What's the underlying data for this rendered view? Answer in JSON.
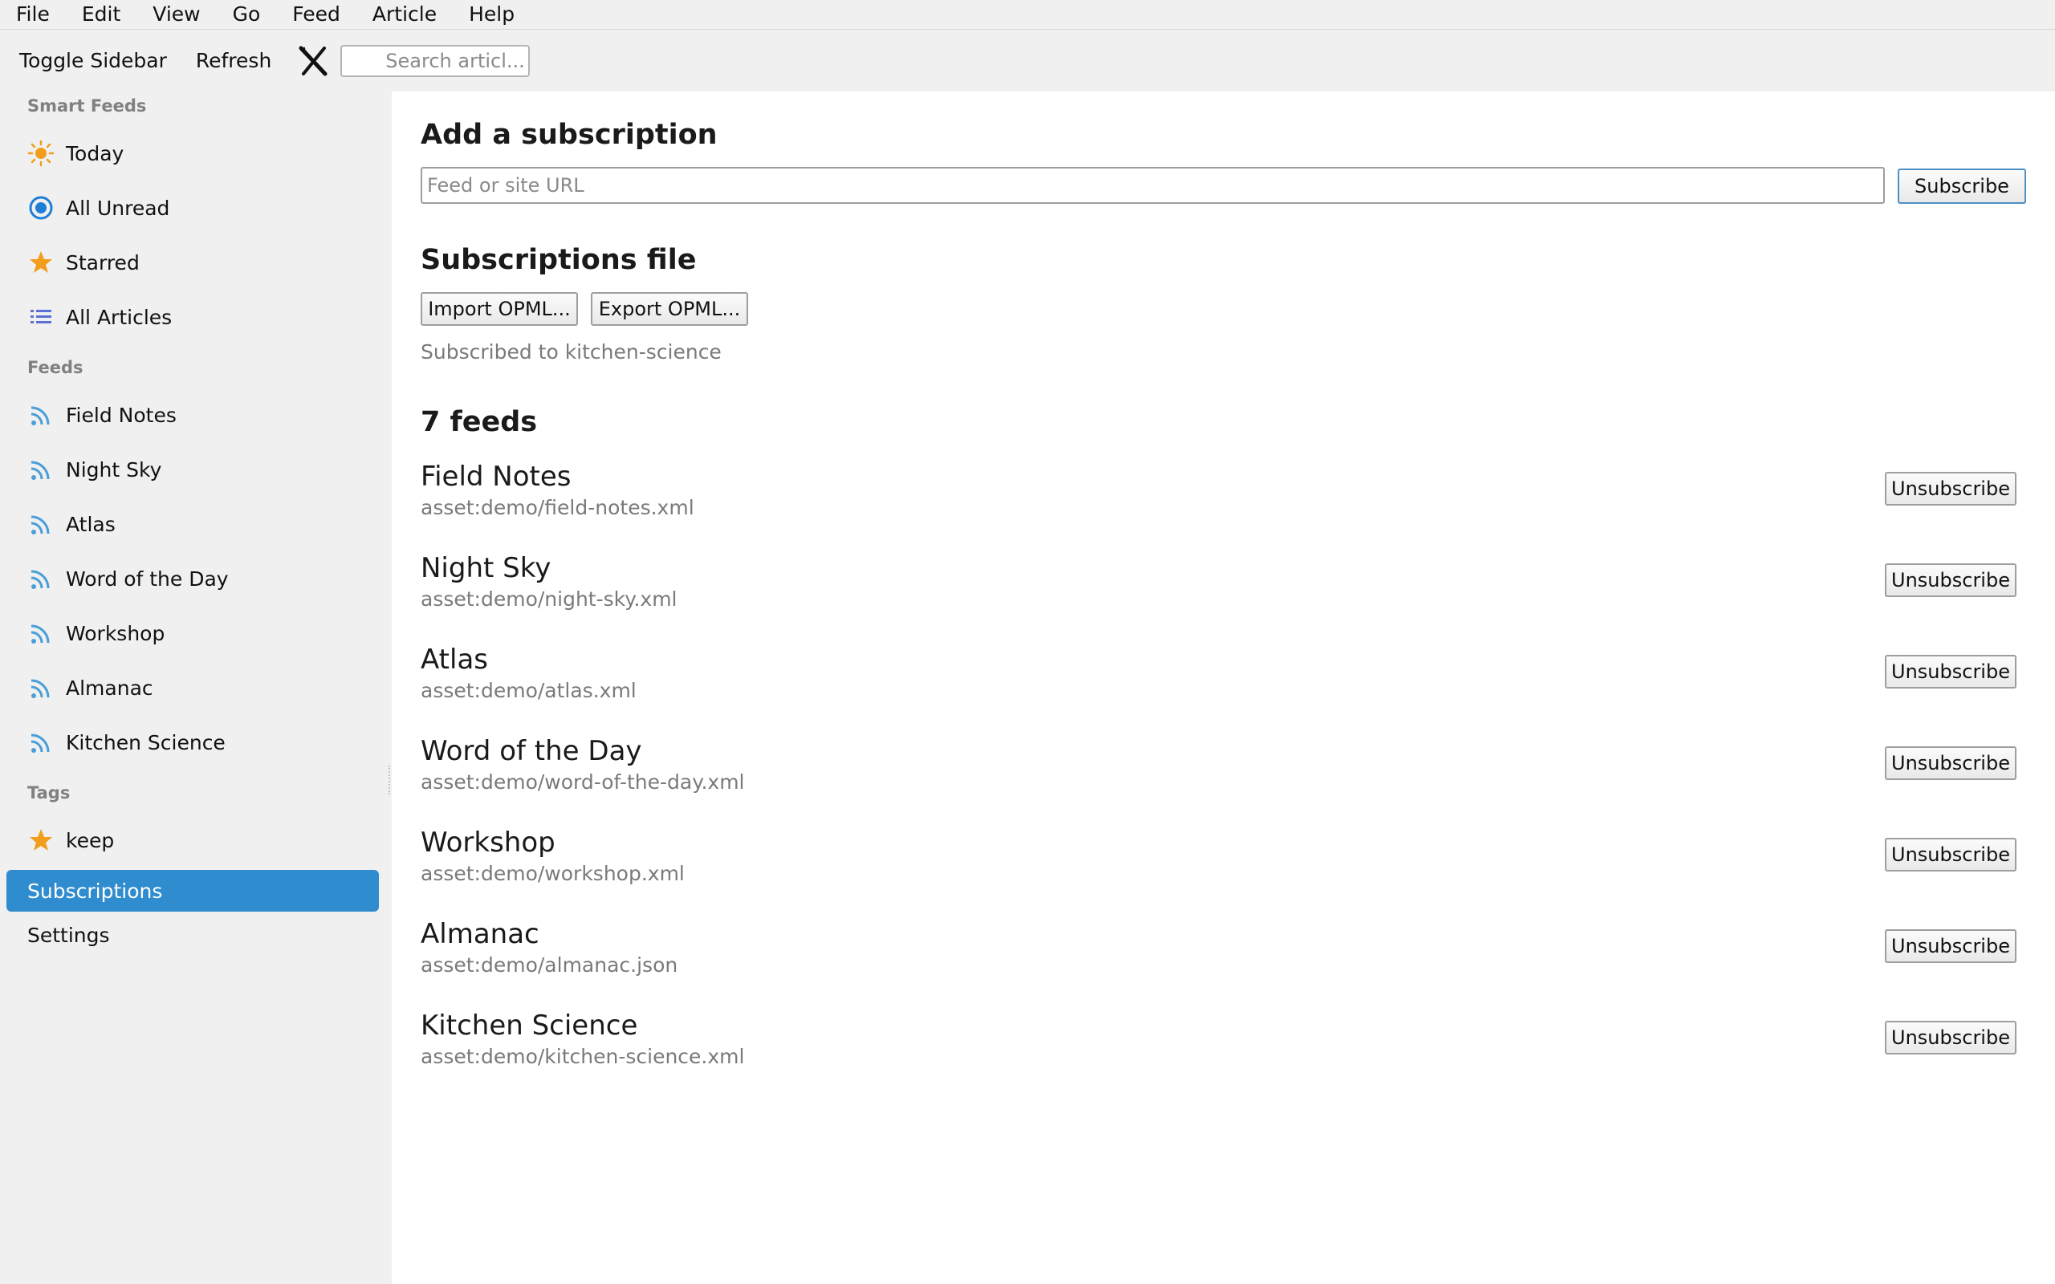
{
  "menu": [
    "File",
    "Edit",
    "View",
    "Go",
    "Feed",
    "Article",
    "Help"
  ],
  "toolbar": {
    "toggle_sidebar": "Toggle Sidebar",
    "refresh": "Refresh",
    "search_placeholder": "Search articl..."
  },
  "sidebar": {
    "smart_feeds_header": "Smart Feeds",
    "smart_feeds": [
      {
        "label": "Today",
        "icon": "sun-icon"
      },
      {
        "label": "All Unread",
        "icon": "unread-dot-icon"
      },
      {
        "label": "Starred",
        "icon": "star-icon"
      },
      {
        "label": "All Articles",
        "icon": "list-icon"
      }
    ],
    "feeds_header": "Feeds",
    "feeds": [
      {
        "label": "Field Notes"
      },
      {
        "label": "Night Sky"
      },
      {
        "label": "Atlas"
      },
      {
        "label": "Word of the Day"
      },
      {
        "label": "Workshop"
      },
      {
        "label": "Almanac"
      },
      {
        "label": "Kitchen Science"
      }
    ],
    "tags_header": "Tags",
    "tags": [
      {
        "label": "keep",
        "icon": "star-icon"
      }
    ],
    "subscriptions": "Subscriptions",
    "settings": "Settings"
  },
  "main": {
    "add_title": "Add a subscription",
    "url_placeholder": "Feed or site URL",
    "subscribe_label": "Subscribe",
    "file_title": "Subscriptions file",
    "import_label": "Import OPML...",
    "export_label": "Export OPML...",
    "status": "Subscribed to kitchen-science",
    "feeds_count_title": "7 feeds",
    "unsubscribe_label": "Unsubscribe",
    "feeds": [
      {
        "title": "Field Notes",
        "url": "asset:demo/field-notes.xml"
      },
      {
        "title": "Night Sky",
        "url": "asset:demo/night-sky.xml"
      },
      {
        "title": "Atlas",
        "url": "asset:demo/atlas.xml"
      },
      {
        "title": "Word of the Day",
        "url": "asset:demo/word-of-the-day.xml"
      },
      {
        "title": "Workshop",
        "url": "asset:demo/workshop.xml"
      },
      {
        "title": "Almanac",
        "url": "asset:demo/almanac.json"
      },
      {
        "title": "Kitchen Science",
        "url": "asset:demo/kitchen-science.xml"
      }
    ]
  },
  "colors": {
    "accent": "#2f8cce",
    "star": "#f29d1b",
    "rss": "#4a9fd8",
    "unread": "#1f7fd6"
  }
}
